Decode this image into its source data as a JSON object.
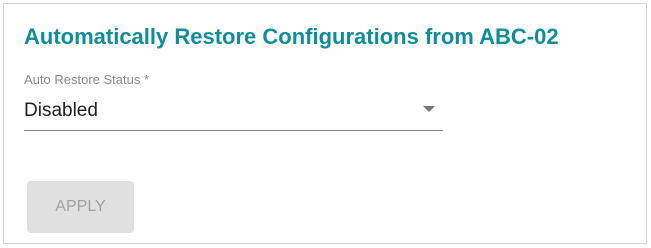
{
  "section": {
    "title": "Automatically Restore Configurations from ABC-02"
  },
  "auto_restore": {
    "label": "Auto Restore Status *",
    "value": "Disabled",
    "arrow_icon": "dropdown-arrow-icon"
  },
  "actions": {
    "apply_label": "APPLY",
    "apply_enabled": false
  },
  "colors": {
    "title": "#0f8d96",
    "label": "#8a8a8a",
    "value": "#212121",
    "button_bg_disabled": "#e0e0e0",
    "button_text_disabled": "#a0a0a0"
  }
}
